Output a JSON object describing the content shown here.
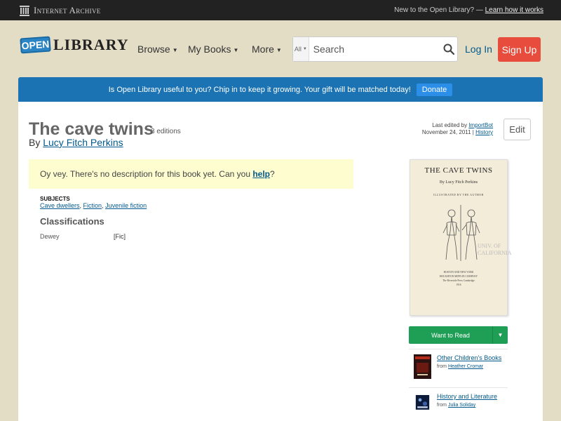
{
  "ia_bar": {
    "brand": "Internet Archive",
    "new_text": "New to the Open Library? —",
    "learn_link": "Learn how it works"
  },
  "header": {
    "logo_open": "OPEN",
    "logo_library": "LIBRARY",
    "nav": [
      {
        "label": "Browse"
      },
      {
        "label": "My Books"
      },
      {
        "label": "More"
      }
    ],
    "search_scope": "All",
    "search_placeholder": "Search",
    "login": "Log In",
    "signup": "Sign Up"
  },
  "donate": {
    "text": "Is Open Library useful to you? Chip in to keep it growing. Your gift will be matched today!",
    "button": "Donate"
  },
  "book": {
    "title": "The cave twins",
    "editions": "3 editions",
    "by": "By",
    "author": "Lucy Fitch Perkins",
    "last_edited_prefix": "Last edited by",
    "last_edited_user": "ImportBot",
    "last_edited_date": "November 24, 2011",
    "history": "History",
    "edit": "Edit",
    "no_desc_text": "Oy vey. There's no description for this book yet. Can you",
    "no_desc_link": "help",
    "no_desc_end": "?",
    "subjects_label": "SUBJECTS",
    "subjects": [
      "Cave dwellers",
      "Fiction",
      "Juvenile fiction"
    ],
    "classifications_heading": "Classifications",
    "dewey_label": "Dewey",
    "dewey_value": "[Fic]"
  },
  "cover": {
    "title": "THE CAVE TWINS",
    "by": "By Lucy Fitch Perkins",
    "illustrated": "ILLUSTRATED BY THE AUTHOR",
    "stamp_line1": "UNIV. OF",
    "stamp_line2": "CALIFORNIA",
    "pub_line1": "BOSTON AND NEW YORK",
    "pub_line2": "HOUGHTON MIFFLIN COMPANY",
    "pub_line3": "The Riverside Press Cambridge",
    "pub_line4": "1916"
  },
  "sidebar": {
    "want_to_read": "Want to Read",
    "lists": [
      {
        "title": "Other Children's Books",
        "from": "from",
        "user": "Heather Cromar"
      },
      {
        "title": "History and Literature",
        "from": "from",
        "user": "Julia Soliday"
      }
    ]
  },
  "colors": {
    "donate_banner": "#1b73b3",
    "signup": "#e74c3c",
    "want_to_read": "#1f9f56",
    "link": "#02598b",
    "no_desc_bg": "#fefdd0"
  }
}
